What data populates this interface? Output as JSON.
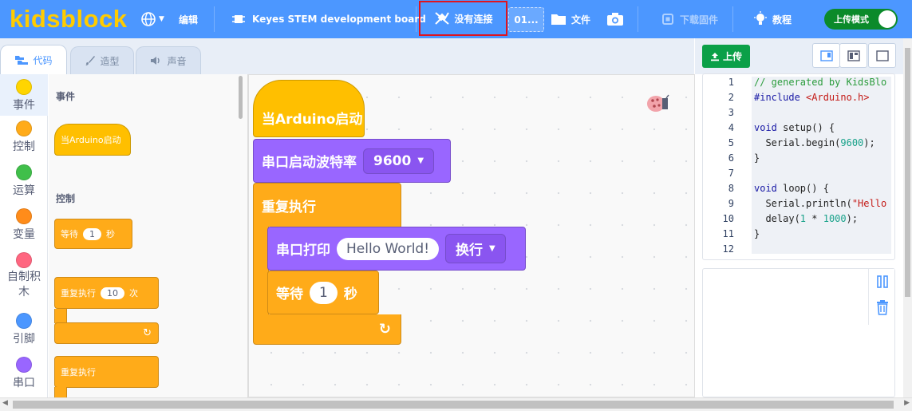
{
  "app": {
    "logo": "kidsblock",
    "edit_label": "编辑",
    "board_label": "Keyes STEM development board",
    "connection_label": "没有连接",
    "port_label": "01...",
    "file_label": "文件",
    "firmware_label": "下载固件",
    "tutorial_label": "教程",
    "mode_label": "上传模式"
  },
  "tabs": [
    {
      "label": "代码"
    },
    {
      "label": "造型"
    },
    {
      "label": "声音"
    }
  ],
  "categories": [
    {
      "label": "事件",
      "color": "#ffd500"
    },
    {
      "label": "控制",
      "color": "#ffab19"
    },
    {
      "label": "运算",
      "color": "#40bf4a"
    },
    {
      "label": "变量",
      "color": "#ff8c1a"
    },
    {
      "label": "自制积\n木",
      "color": "#ff6680"
    },
    {
      "label": "引脚",
      "color": "#4c97ff"
    },
    {
      "label": "串口",
      "color": "#9966ff"
    }
  ],
  "palette": {
    "events_title": "事件",
    "control_title": "控制",
    "when_start": "当Arduino启动",
    "wait_label": "等待",
    "wait_value": "1",
    "wait_unit": "秒",
    "repeat_label": "重复执行",
    "repeat_value": "10",
    "repeat_unit": "次",
    "forever_label": "重复执行"
  },
  "workspace": {
    "hat": "当Arduino启动",
    "baud_label": "串口启动波特率",
    "baud_value": "9600",
    "forever": "重复执行",
    "print_label": "串口打印",
    "print_value": "Hello World!",
    "newline_option": "换行",
    "wait_label": "等待",
    "wait_value": "1",
    "wait_unit": "秒"
  },
  "code_panel": {
    "upload_label": "上传",
    "lines": [
      {
        "n": "1",
        "html": "<span class=\"cmt\">// generated by KidsBlo</span>"
      },
      {
        "n": "2",
        "html": "<span class=\"kw\">#include</span> <span class=\"str\">&lt;Arduino.h&gt;</span>"
      },
      {
        "n": "3",
        "html": ""
      },
      {
        "n": "4",
        "html": "<span class=\"kw\">void</span> setup() {"
      },
      {
        "n": "5",
        "html": "  Serial.begin(<span class=\"num\">9600</span>);"
      },
      {
        "n": "6",
        "html": "}"
      },
      {
        "n": "7",
        "html": ""
      },
      {
        "n": "8",
        "html": "<span class=\"kw\">void</span> loop() {"
      },
      {
        "n": "9",
        "html": "  Serial.println(<span class=\"str\">\"Hello</span>"
      },
      {
        "n": "10",
        "html": "  delay(<span class=\"num\">1</span> * <span class=\"num\">1000</span>);"
      },
      {
        "n": "11",
        "html": "}"
      },
      {
        "n": "12",
        "html": ""
      }
    ]
  },
  "colors": {
    "topbar": "#4c97ff",
    "control": "#ffab19",
    "serial": "#9966ff",
    "upload_green": "#0ba048"
  }
}
